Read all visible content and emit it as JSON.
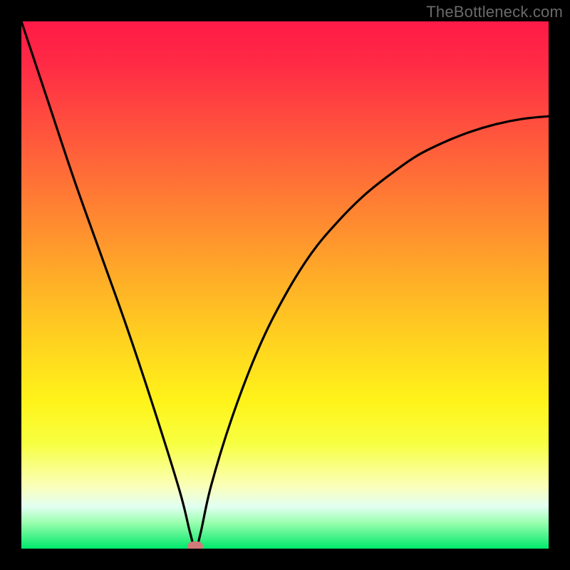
{
  "attribution": "TheBottleneck.com",
  "chart_data": {
    "type": "line",
    "title": "",
    "xlabel": "",
    "ylabel": "",
    "xlim": [
      0,
      100
    ],
    "ylim": [
      0,
      100
    ],
    "grid": false,
    "series": [
      {
        "name": "curve",
        "x": [
          0,
          5,
          10,
          15,
          20,
          25,
          30,
          32,
          33,
          34,
          36,
          40,
          45,
          50,
          55,
          60,
          65,
          70,
          75,
          80,
          85,
          90,
          95,
          100
        ],
        "y": [
          100,
          85,
          70,
          56,
          42,
          27,
          11,
          3,
          0,
          3,
          12,
          25,
          38,
          48,
          56,
          62,
          67,
          71,
          74.5,
          77,
          79,
          80.5,
          81.5,
          82
        ]
      }
    ],
    "marker": {
      "x_pct": 33,
      "y_pct": 0,
      "color": "#d17a7a"
    },
    "colors": {
      "curve": "#000000",
      "background_top": "#ff1a47",
      "background_bottom": "#00e86b",
      "frame": "#000000"
    }
  }
}
